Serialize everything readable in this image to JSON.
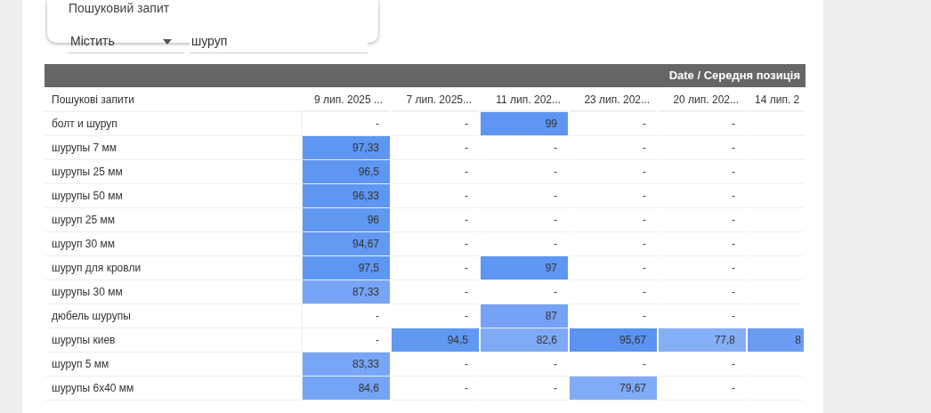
{
  "filter": {
    "label": "Пошуковий запит",
    "operator": "Містить",
    "value": "шуруп"
  },
  "table": {
    "group_header": "Date / Середня позиція",
    "columns": [
      "Пошукові запити",
      "9 лип. 2025 ...",
      "7 лип. 2025...",
      "11 лип. 202...",
      "23 лип. 202...",
      "20 лип. 202...",
      "14 лип. 2"
    ],
    "rows": [
      {
        "cells": [
          {
            "value": "болт и шуруп"
          },
          {
            "value": "-"
          },
          {
            "value": "-"
          },
          {
            "value": "99",
            "color": "#5f95f2"
          },
          {
            "value": "-"
          },
          {
            "value": "-"
          },
          {}
        ]
      },
      {
        "cells": [
          {
            "value": "шурупы 7 мм"
          },
          {
            "value": "97,33",
            "color": "#5e96f3"
          },
          {
            "value": "-"
          },
          {
            "value": "-"
          },
          {
            "value": "-"
          },
          {
            "value": "-"
          },
          {}
        ]
      },
      {
        "cells": [
          {
            "value": "шурупы 25 мм"
          },
          {
            "value": "96,5",
            "color": "#5f96f2"
          },
          {
            "value": "-"
          },
          {
            "value": "-"
          },
          {
            "value": "-"
          },
          {
            "value": "-"
          },
          {}
        ]
      },
      {
        "cells": [
          {
            "value": "шурупы 50 мм"
          },
          {
            "value": "96,33",
            "color": "#5f96f2"
          },
          {
            "value": "-"
          },
          {
            "value": "-"
          },
          {
            "value": "-"
          },
          {
            "value": "-"
          },
          {}
        ]
      },
      {
        "cells": [
          {
            "value": "шуруп 25 мм"
          },
          {
            "value": "96",
            "color": "#6098f2"
          },
          {
            "value": "-"
          },
          {
            "value": "-"
          },
          {
            "value": "-"
          },
          {
            "value": "-"
          },
          {}
        ]
      },
      {
        "cells": [
          {
            "value": "шуруп 30 мм"
          },
          {
            "value": "94,67",
            "color": "#6399f3"
          },
          {
            "value": "-"
          },
          {
            "value": "-"
          },
          {
            "value": "-"
          },
          {
            "value": "-"
          },
          {}
        ]
      },
      {
        "cells": [
          {
            "value": "шуруп для кровли"
          },
          {
            "value": "97,5",
            "color": "#5e96f3"
          },
          {
            "value": "-"
          },
          {
            "value": "97",
            "color": "#5e96f3"
          },
          {
            "value": "-"
          },
          {
            "value": "-"
          },
          {}
        ]
      },
      {
        "cells": [
          {
            "value": "шурупы 30 мм"
          },
          {
            "value": "87,33",
            "color": "#76a5f5"
          },
          {
            "value": "-"
          },
          {
            "value": "-"
          },
          {
            "value": "-"
          },
          {
            "value": "-"
          },
          {}
        ]
      },
      {
        "cells": [
          {
            "value": "дюбель шурупы"
          },
          {
            "value": "-"
          },
          {
            "value": "-"
          },
          {
            "value": "87",
            "color": "#74a3f5"
          },
          {
            "value": "-"
          },
          {
            "value": "-"
          },
          {}
        ]
      },
      {
        "cells": [
          {
            "value": "шурупы киев"
          },
          {
            "value": "-"
          },
          {
            "value": "94,5",
            "color": "#6098f2"
          },
          {
            "value": "82,6",
            "color": "#7ea9f5"
          },
          {
            "value": "95,67",
            "color": "#5b93f1"
          },
          {
            "value": "77,8",
            "color": "#84aff7"
          },
          {
            "value": "8",
            "color": "#6a9cf3"
          }
        ]
      },
      {
        "cells": [
          {
            "value": "шуруп 5 мм"
          },
          {
            "value": "83,33",
            "color": "#77a6f6"
          },
          {
            "value": "-"
          },
          {
            "value": "-"
          },
          {
            "value": "-"
          },
          {
            "value": "-"
          },
          {}
        ]
      },
      {
        "cells": [
          {
            "value": "шурупы 6х40 мм"
          },
          {
            "value": "84,6",
            "color": "#74a4f5"
          },
          {
            "value": "-"
          },
          {
            "value": "-"
          },
          {
            "value": "79,67",
            "color": "#80abf6"
          },
          {
            "value": "-"
          },
          {}
        ]
      }
    ]
  }
}
